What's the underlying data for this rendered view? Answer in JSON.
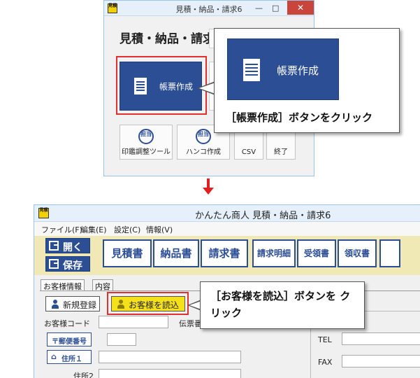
{
  "launcher": {
    "window_title": "見積・納品・請求6",
    "close_glyph": "✕",
    "minimize_glyph": "—",
    "maximize_glyph": "□",
    "app_icon_text": "見積",
    "heading": "見積・納品・請求 6",
    "main_tile_label": "帳票作成",
    "tools": [
      {
        "label": "印鑑調整ツール",
        "icon_text": "担当"
      },
      {
        "label": "ハンコ作成",
        "icon_text": "担当"
      },
      {
        "label": "CSV"
      },
      {
        "label": "終了"
      }
    ]
  },
  "callout1": {
    "tile_label": "帳票作成",
    "instruction": "［帳票作成］ボタンをクリック"
  },
  "main_window": {
    "title": "かんたん商人 見積・納品・請求6",
    "app_icon_text": "見積",
    "menu": [
      "ファイル(F)",
      "編集(E)",
      "設定(C)",
      "情報(V)"
    ],
    "nav_buttons": [
      "開く",
      "保存"
    ],
    "doc_buttons": [
      "見積書",
      "納品書",
      "請求書",
      "請求明細",
      "受領書",
      "領収書"
    ],
    "tabs": [
      "お客様情報",
      "内容"
    ],
    "register_button": "新規登録",
    "load_customer_button": "お客様を読込",
    "customer_code_label": "お客様コード",
    "slip_number_label": "伝票番",
    "postal_button": "〒郵便番号",
    "address1_button": "住所１",
    "address2_label": "住所2",
    "tel_label": "TEL",
    "fax_label": "FAX"
  },
  "callout2": {
    "instruction": "［お客様を読込］ボタンを クリック"
  },
  "colors": {
    "accent_blue": "#2c4e95",
    "highlight_red": "#e23030",
    "toolbar_yellow": "#f0e9b6",
    "load_button_yellow": "#f5e11a"
  }
}
